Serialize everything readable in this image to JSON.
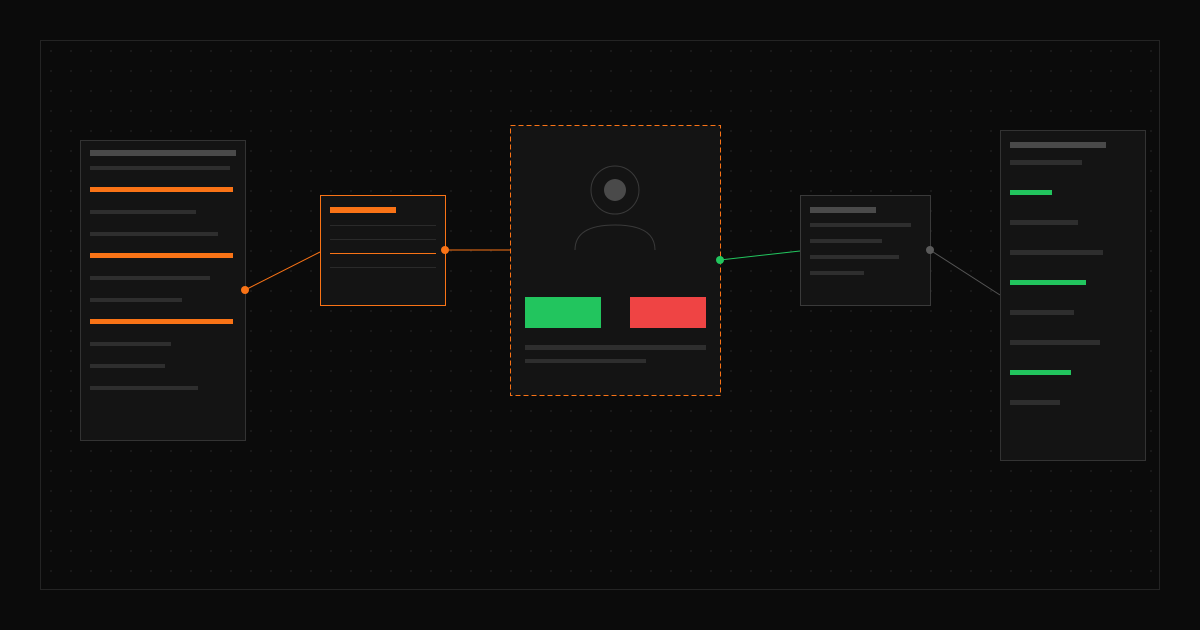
{
  "colors": {
    "background": "#0b0b0b",
    "frame_border": "#242424",
    "panel_bg": "#141414",
    "panel_border": "#333333",
    "muted_line": "#2e2e2e",
    "title_line": "#4a4a4a",
    "accent_orange": "#f97316",
    "accent_green": "#22c55e",
    "accent_red": "#ef4444",
    "neutral_dot": "#5a5a5a",
    "avatar": "#4a4a4a"
  },
  "diagram": {
    "nodes": [
      {
        "id": "left-list-panel",
        "role": "list",
        "accent": "orange",
        "highlighted_rows": 3
      },
      {
        "id": "selected-item-card",
        "role": "filtered-selection",
        "accent": "orange"
      },
      {
        "id": "profile-card",
        "role": "focused-profile",
        "selection": "dashed-orange",
        "actions": [
          "accept",
          "reject"
        ]
      },
      {
        "id": "summary-card",
        "role": "summary",
        "accent": "neutral"
      },
      {
        "id": "right-list-panel",
        "role": "list",
        "accent": "green",
        "highlighted_rows": 3
      }
    ],
    "edges": [
      {
        "from": "left-list-panel",
        "to": "selected-item-card",
        "color": "orange"
      },
      {
        "from": "selected-item-card",
        "to": "profile-card",
        "color": "orange"
      },
      {
        "from": "profile-card",
        "to": "summary-card",
        "color": "green"
      },
      {
        "from": "summary-card",
        "to": "right-list-panel",
        "color": "neutral"
      }
    ]
  }
}
